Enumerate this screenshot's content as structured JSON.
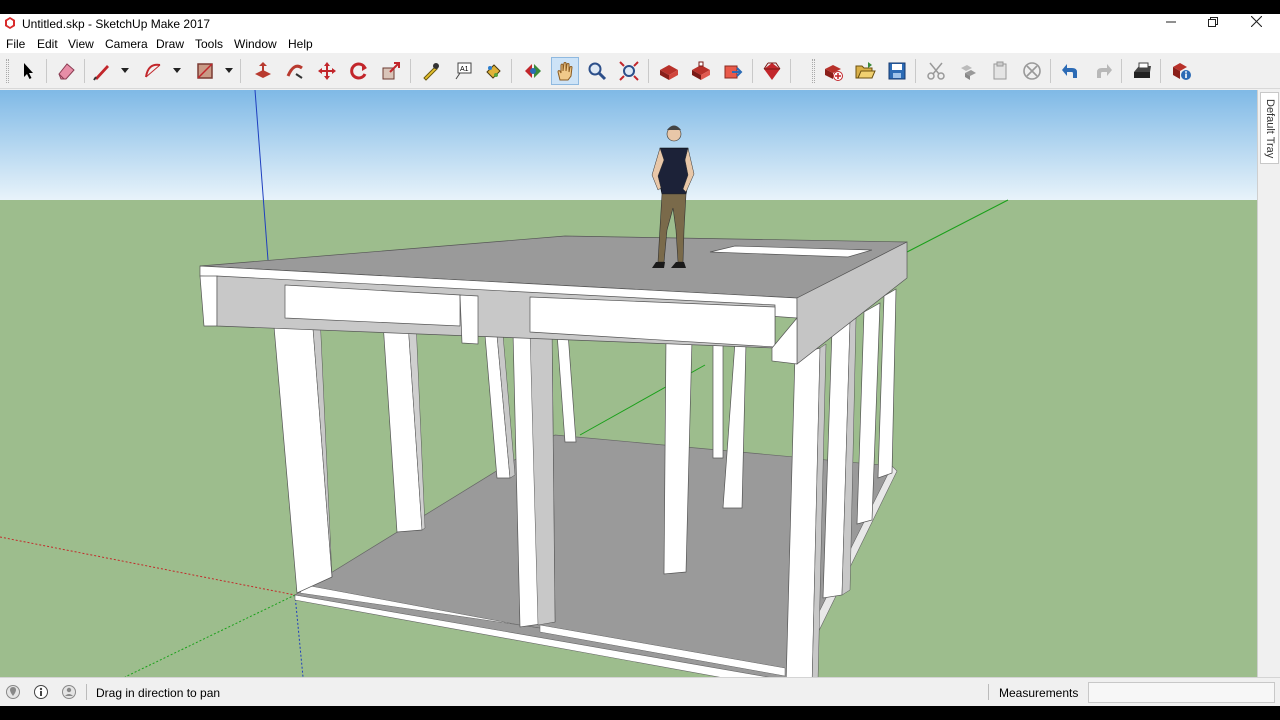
{
  "window": {
    "title": "Untitled.skp - SketchUp Make 2017",
    "controls": [
      "minimize",
      "restore",
      "close"
    ]
  },
  "menu": [
    "File",
    "Edit",
    "View",
    "Camera",
    "Draw",
    "Tools",
    "Window",
    "Help"
  ],
  "toolbar": {
    "tools": [
      {
        "name": "select-icon"
      },
      {
        "name": "eraser-icon"
      },
      {
        "name": "line-icon"
      },
      {
        "name": "arc-icon"
      },
      {
        "name": "shape-icon"
      },
      {
        "name": "push-pull-icon"
      },
      {
        "name": "follow-me-icon"
      },
      {
        "name": "move-icon"
      },
      {
        "name": "rotate-icon"
      },
      {
        "name": "scale-icon"
      },
      {
        "name": "tape-measure-icon"
      },
      {
        "name": "text-icon"
      },
      {
        "name": "paint-bucket-icon"
      },
      {
        "name": "orbit-icon"
      },
      {
        "name": "pan-icon",
        "active": true
      },
      {
        "name": "zoom-icon"
      },
      {
        "name": "zoom-extents-icon"
      },
      {
        "name": "3d-warehouse-icon"
      },
      {
        "name": "extension-warehouse-icon"
      },
      {
        "name": "send-to-layout-icon"
      },
      {
        "name": "extension-manager-icon"
      },
      {
        "name": "new-icon"
      },
      {
        "name": "open-icon"
      },
      {
        "name": "save-icon"
      },
      {
        "name": "cut-icon"
      },
      {
        "name": "copy-icon"
      },
      {
        "name": "paste-icon"
      },
      {
        "name": "erase-icon"
      },
      {
        "name": "undo-icon"
      },
      {
        "name": "redo-icon"
      },
      {
        "name": "print-icon"
      },
      {
        "name": "model-info-icon"
      }
    ]
  },
  "tray": {
    "label": "Default Tray"
  },
  "status": {
    "hint": "Drag in direction to pan",
    "measurements_label": "Measurements",
    "measurements_value": ""
  },
  "colors": {
    "sky_top": "#7fb9e6",
    "sky_bottom": "#e8f3fa",
    "ground": "#9dbd8d",
    "model_face": "#ffffff",
    "model_shade": "#c8c8c8",
    "floor": "#9a9a9a",
    "active_tool": "#cde3f7"
  }
}
